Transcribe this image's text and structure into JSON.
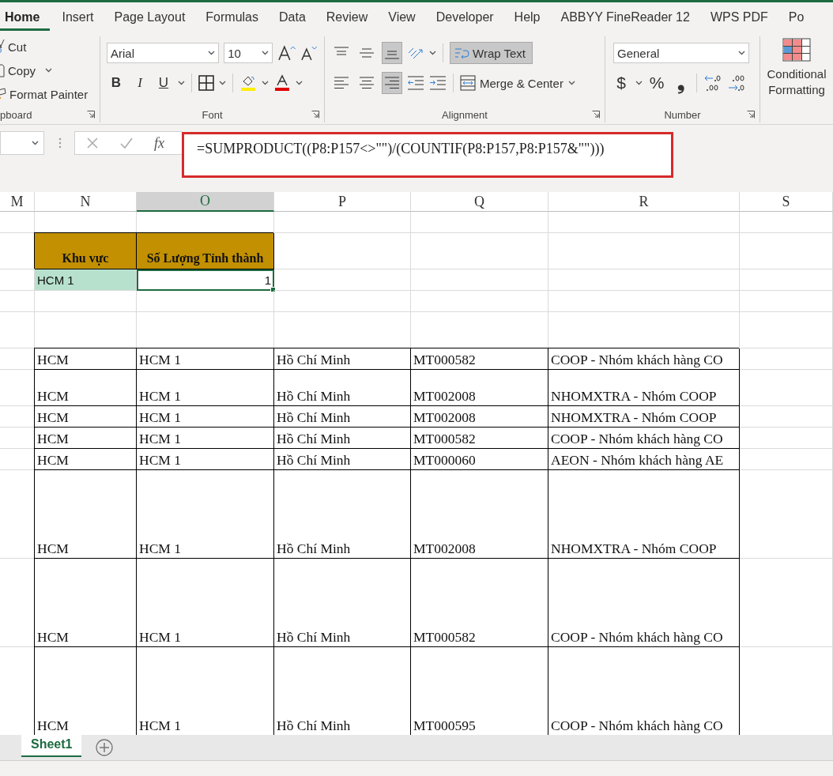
{
  "ribbon_tabs": [
    {
      "label": "Home",
      "selected": true
    },
    {
      "label": "Insert",
      "selected": false
    },
    {
      "label": "Page Layout",
      "selected": false
    },
    {
      "label": "Formulas",
      "selected": false
    },
    {
      "label": "Data",
      "selected": false
    },
    {
      "label": "Review",
      "selected": false
    },
    {
      "label": "View",
      "selected": false
    },
    {
      "label": "Developer",
      "selected": false
    },
    {
      "label": "Help",
      "selected": false
    },
    {
      "label": "ABBYY FineReader 12",
      "selected": false
    },
    {
      "label": "WPS PDF",
      "selected": false
    },
    {
      "label": "Po",
      "selected": false
    }
  ],
  "clipboard": {
    "cut": "Cut",
    "copy": "Copy",
    "format_painter": "Format Painter",
    "group_label": "pboard"
  },
  "font": {
    "name": "Arial",
    "size": "10",
    "bold": "B",
    "italic": "I",
    "underline": "U",
    "group_label": "Font"
  },
  "alignment": {
    "vertical_buttons": [
      {
        "selected": false
      },
      {
        "selected": false
      },
      {
        "selected": true
      }
    ],
    "horizontal_buttons": [
      {
        "selected": false
      },
      {
        "selected": false
      },
      {
        "selected": true
      }
    ],
    "wrap_text": {
      "label": "Wrap Text",
      "selected": true
    },
    "merge": "Merge & Center",
    "group_label": "Alignment"
  },
  "number": {
    "format": "General",
    "currency": "$",
    "percent": "%",
    "comma": "❟",
    "group_label": "Number"
  },
  "styles": {
    "conditional_formatting": "Conditional Formatting"
  },
  "formula_bar": {
    "fx": "fx",
    "formula": "=SUMPRODUCT((P8:P157<>\"\")/(COUNTIF(P8:P157,P8:P157&\"\")))",
    "highlighted": true
  },
  "columns": [
    {
      "label": "M",
      "selected": false
    },
    {
      "label": "N",
      "selected": false
    },
    {
      "label": "O",
      "selected": true
    },
    {
      "label": "P",
      "selected": false
    },
    {
      "label": "Q",
      "selected": false
    },
    {
      "label": "R",
      "selected": false
    },
    {
      "label": "S",
      "selected": false
    }
  ],
  "rows": [
    {
      "kind": "single",
      "cells": {}
    },
    {
      "kind": "double",
      "cells": {
        "N": {
          "kind": "header",
          "text": "Khu vực",
          "selected": false
        },
        "O": {
          "kind": "header",
          "text": "Số Lượng Tỉnh thành",
          "selected": false
        }
      }
    },
    {
      "kind": "single",
      "cells": {
        "N": {
          "kind": "region",
          "text": "HCM 1",
          "selected": false
        },
        "O": {
          "kind": "count",
          "text": "1",
          "selected": true
        }
      }
    },
    {
      "kind": "single",
      "cells": {}
    },
    {
      "kind": "double",
      "cells": {}
    },
    {
      "kind": "single",
      "cells": {
        "N": {
          "kind": "data",
          "text": "HCM",
          "selected": false
        },
        "O": {
          "kind": "data",
          "text": "HCM 1",
          "selected": false
        },
        "P": {
          "kind": "data",
          "text": "Hồ Chí Minh",
          "selected": false
        },
        "Q": {
          "kind": "data",
          "text": "MT000582",
          "selected": false
        },
        "R": {
          "kind": "data",
          "text": "COOP - Nhóm khách hàng CO",
          "selected": false
        }
      }
    },
    {
      "kind": "double",
      "cells": {
        "N": {
          "kind": "data",
          "text": "HCM",
          "selected": false
        },
        "O": {
          "kind": "data",
          "text": "HCM 1",
          "selected": false
        },
        "P": {
          "kind": "data",
          "text": "Hồ Chí Minh",
          "selected": false
        },
        "Q": {
          "kind": "data",
          "text": "MT002008",
          "selected": false
        },
        "R": {
          "kind": "data",
          "text": "NHOMXTRA - Nhóm COOP",
          "selected": false
        }
      }
    },
    {
      "kind": "single",
      "cells": {
        "N": {
          "kind": "data",
          "text": "HCM",
          "selected": false
        },
        "O": {
          "kind": "data",
          "text": "HCM 1",
          "selected": false
        },
        "P": {
          "kind": "data",
          "text": "Hồ Chí Minh",
          "selected": false
        },
        "Q": {
          "kind": "data",
          "text": "MT002008",
          "selected": false
        },
        "R": {
          "kind": "data",
          "text": "NHOMXTRA - Nhóm COOP",
          "selected": false
        }
      }
    },
    {
      "kind": "single",
      "cells": {
        "N": {
          "kind": "data",
          "text": "HCM",
          "selected": false
        },
        "O": {
          "kind": "data",
          "text": "HCM 1",
          "selected": false
        },
        "P": {
          "kind": "data",
          "text": "Hồ Chí Minh",
          "selected": false
        },
        "Q": {
          "kind": "data",
          "text": "MT000582",
          "selected": false
        },
        "R": {
          "kind": "data",
          "text": "COOP - Nhóm khách hàng CO",
          "selected": false
        }
      }
    },
    {
      "kind": "single",
      "cells": {
        "N": {
          "kind": "data",
          "text": "HCM",
          "selected": false
        },
        "O": {
          "kind": "data",
          "text": "HCM 1",
          "selected": false
        },
        "P": {
          "kind": "data",
          "text": "Hồ Chí Minh",
          "selected": false
        },
        "Q": {
          "kind": "data",
          "text": "MT000060",
          "selected": false
        },
        "R": {
          "kind": "data",
          "text": "AEON - Nhóm khách hàng AE",
          "selected": false
        }
      }
    },
    {
      "kind": "tall",
      "cells": {
        "N": {
          "kind": "data",
          "text": "HCM",
          "selected": false
        },
        "O": {
          "kind": "data",
          "text": "HCM 1",
          "selected": false
        },
        "P": {
          "kind": "data",
          "text": "Hồ Chí Minh",
          "selected": false
        },
        "Q": {
          "kind": "data",
          "text": "MT002008",
          "selected": false
        },
        "R": {
          "kind": "data",
          "text": "NHOMXTRA - Nhóm COOP",
          "selected": false
        }
      }
    },
    {
      "kind": "tall",
      "cells": {
        "N": {
          "kind": "data",
          "text": "HCM",
          "selected": false
        },
        "O": {
          "kind": "data",
          "text": "HCM 1",
          "selected": false
        },
        "P": {
          "kind": "data",
          "text": "Hồ Chí Minh",
          "selected": false
        },
        "Q": {
          "kind": "data",
          "text": "MT000582",
          "selected": false
        },
        "R": {
          "kind": "data",
          "text": "COOP - Nhóm khách hàng CO",
          "selected": false
        }
      }
    },
    {
      "kind": "tall",
      "cells": {
        "N": {
          "kind": "data",
          "text": "HCM",
          "selected": false
        },
        "O": {
          "kind": "data",
          "text": "HCM 1",
          "selected": false
        },
        "P": {
          "kind": "data",
          "text": "Hồ Chí Minh",
          "selected": false
        },
        "Q": {
          "kind": "data",
          "text": "MT000595",
          "selected": false
        },
        "R": {
          "kind": "data",
          "text": "COOP - Nhóm khách hàng CO",
          "selected": false
        }
      }
    }
  ],
  "sheet_tabs": [
    {
      "label": "Sheet1",
      "selected": true
    }
  ]
}
